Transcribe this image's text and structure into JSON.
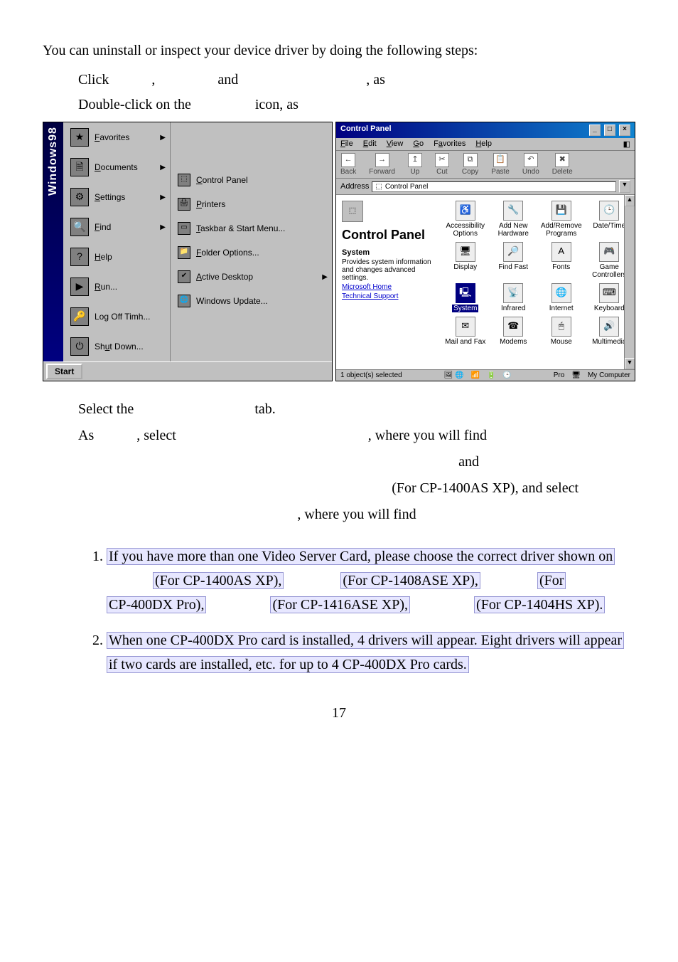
{
  "intro": "You can uninstall or inspect your device driver by doing the following steps:",
  "step1": {
    "a": "Click",
    "b": ",",
    "c": "and",
    "d": ", as"
  },
  "step2": {
    "a": "Double-click on the",
    "b": "icon, as"
  },
  "startmenu": {
    "stripe": "Windows98",
    "col1": {
      "favorites": "Favorites",
      "documents": "Documents",
      "settings": "Settings",
      "find": "Find",
      "help": "Help",
      "run": "Run...",
      "logoff": "Log Off Timh...",
      "shutdown": "Shut Down..."
    },
    "col2": {
      "controlpanel": "Control Panel",
      "printers": "Printers",
      "taskbar": "Taskbar & Start Menu...",
      "folder": "Folder Options...",
      "active": "Active Desktop",
      "update": "Windows Update..."
    },
    "startbtn": "Start"
  },
  "cpanel": {
    "title": "Control Panel",
    "menu": {
      "file": "File",
      "edit": "Edit",
      "view": "View",
      "go": "Go",
      "favorites": "Favorites",
      "help": "Help"
    },
    "tb": {
      "back": "Back",
      "forward": "Forward",
      "up": "Up",
      "cut": "Cut",
      "copy": "Copy",
      "paste": "Paste",
      "undo": "Undo",
      "delete": "Delete"
    },
    "addr_label": "Address",
    "addr_value": "Control Panel",
    "side": {
      "heading": "Control Panel",
      "system_bold": "System",
      "desc": "Provides system information and changes advanced settings.",
      "link1": "Microsoft Home",
      "link2": "Technical Support"
    },
    "icons": {
      "accessibility": "Accessibility Options",
      "addnew": "Add New Hardware",
      "addremove": "Add/Remove Programs",
      "datetime": "Date/Time",
      "display": "Display",
      "findfast": "Find Fast",
      "fonts": "Fonts",
      "game": "Game Controllers",
      "system": "System",
      "infrared": "Infrared",
      "internet": "Internet",
      "keyboard": "Keyboard",
      "mailfax": "Mail and Fax",
      "modems": "Modems",
      "mouse": "Mouse",
      "multimedia": "Multimedia"
    },
    "status_left": "1 object(s) selected",
    "status_mid_label": "Pro",
    "status_right": "My Computer"
  },
  "after": {
    "select": "Select the",
    "tab": "tab.",
    "as": "As",
    "sel2": ", select",
    "where": ", where you will find",
    "and": "and",
    "forcp": "(For CP-1400AS XP), and select",
    "where2": ", where you will find"
  },
  "notes": {
    "n1a": "If you have more than one Video Server Card, please choose the correct driver shown on",
    "n1b": "(For CP-1400AS XP),",
    "n1c": "(For CP-1408ASE XP),",
    "n1d": "(For",
    "n1e": "CP-400DX Pro),",
    "n1f": "(For CP-1416ASE XP),",
    "n1g": "(For CP-1404HS XP).",
    "n2a": "When one CP-400DX Pro card is installed, 4 drivers will appear. Eight drivers will appear",
    "n2b": "if two cards are installed, etc. for up to 4 CP-400DX Pro cards."
  },
  "pagenum": "17"
}
